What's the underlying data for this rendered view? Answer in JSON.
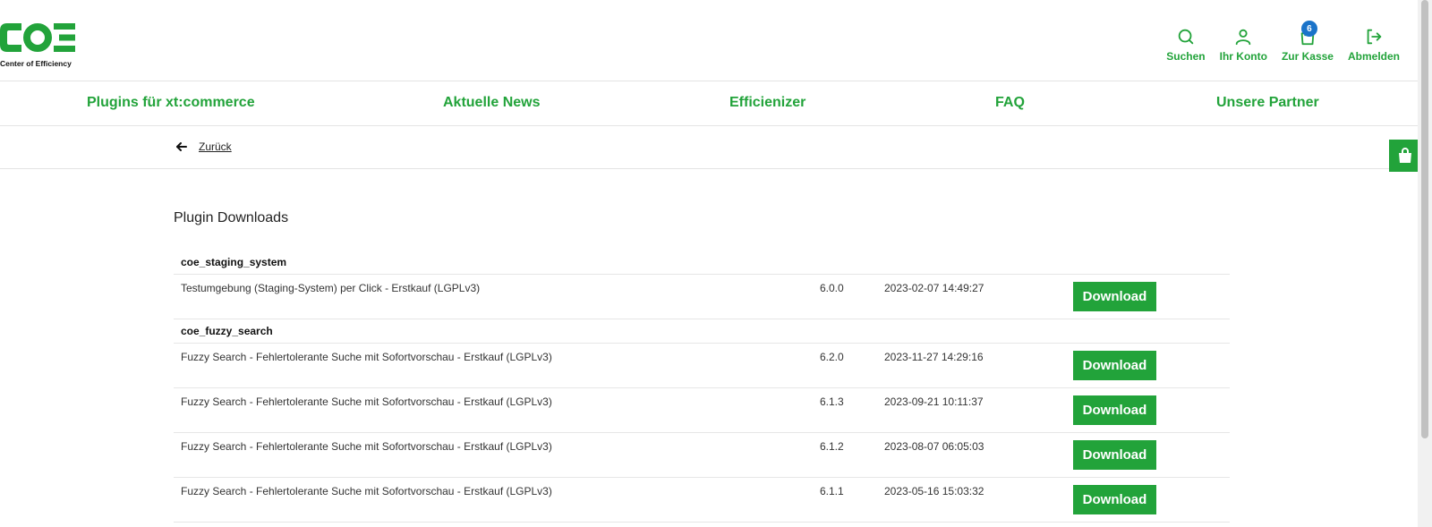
{
  "brand": {
    "logo_text": "COE",
    "caption": "Center of Efficiency",
    "color": "#22a33a"
  },
  "header_actions": [
    {
      "label": "Suchen",
      "icon": "search-icon"
    },
    {
      "label": "Ihr Konto",
      "icon": "user-icon"
    },
    {
      "label": "Zur Kasse",
      "icon": "shopping-bag-icon",
      "badge": "6"
    },
    {
      "label": "Abmelden",
      "icon": "logout-icon"
    }
  ],
  "nav": [
    {
      "label": "Plugins für xt:commerce"
    },
    {
      "label": "Aktuelle News"
    },
    {
      "label": "Efficienizer"
    },
    {
      "label": "FAQ"
    },
    {
      "label": "Unsere Partner"
    }
  ],
  "back": {
    "label": "Zurück"
  },
  "page_title": "Plugin Downloads",
  "download_label": "Download",
  "groups": [
    {
      "name": "coe_staging_system",
      "items": [
        {
          "desc": "Testumgebung (Staging-System) per Click - Erstkauf (LGPLv3)",
          "version": "6.0.0",
          "date": "2023-02-07 14:49:27"
        }
      ]
    },
    {
      "name": "coe_fuzzy_search",
      "items": [
        {
          "desc": "Fuzzy Search - Fehlertolerante Suche mit Sofortvorschau - Erstkauf (LGPLv3)",
          "version": "6.2.0",
          "date": "2023-11-27 14:29:16"
        },
        {
          "desc": "Fuzzy Search - Fehlertolerante Suche mit Sofortvorschau - Erstkauf (LGPLv3)",
          "version": "6.1.3",
          "date": "2023-09-21 10:11:37"
        },
        {
          "desc": "Fuzzy Search - Fehlertolerante Suche mit Sofortvorschau - Erstkauf (LGPLv3)",
          "version": "6.1.2",
          "date": "2023-08-07 06:05:03"
        },
        {
          "desc": "Fuzzy Search - Fehlertolerante Suche mit Sofortvorschau - Erstkauf (LGPLv3)",
          "version": "6.1.1",
          "date": "2023-05-16 15:03:32"
        }
      ]
    }
  ],
  "colors": {
    "accent": "#22a33a",
    "badge": "#1a73c9"
  }
}
